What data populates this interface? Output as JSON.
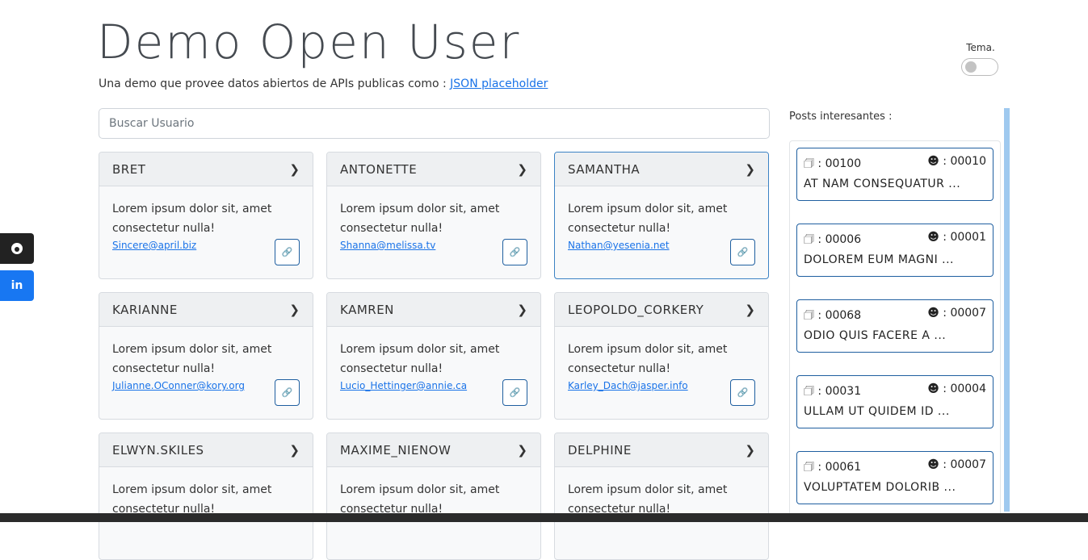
{
  "header": {
    "title": "Demo Open User",
    "subtitle": "Una demo que provee datos abiertos de APIs publicas como : ",
    "subtitle_link": "JSON placeholder",
    "theme_label": "Tema."
  },
  "search": {
    "placeholder": "Buscar Usuario"
  },
  "users": [
    {
      "name": "BRET",
      "text": "Lorem ipsum dolor sit, amet consectetur nulla!",
      "email": "Sincere@april.biz"
    },
    {
      "name": "ANTONETTE",
      "text": "Lorem ipsum dolor sit, amet consectetur nulla!",
      "email": "Shanna@melissa.tv"
    },
    {
      "name": "SAMANTHA",
      "text": "Lorem ipsum dolor sit, amet consectetur nulla!",
      "email": "Nathan@yesenia.net"
    },
    {
      "name": "KARIANNE",
      "text": "Lorem ipsum dolor sit, amet consectetur nulla!",
      "email": "Julianne.OConner@kory.org"
    },
    {
      "name": "KAMREN",
      "text": "Lorem ipsum dolor sit, amet consectetur nulla!",
      "email": "Lucio_Hettinger@annie.ca"
    },
    {
      "name": "LEOPOLDO_CORKERY",
      "text": "Lorem ipsum dolor sit, amet consectetur nulla!",
      "email": "Karley_Dach@jasper.info"
    },
    {
      "name": "ELWYN.SKILES",
      "text": "Lorem ipsum dolor sit, amet consectetur nulla!",
      "email": ""
    },
    {
      "name": "MAXIME_NIENOW",
      "text": "Lorem ipsum dolor sit, amet consectetur nulla!",
      "email": ""
    },
    {
      "name": "DELPHINE",
      "text": "Lorem ipsum dolor sit, amet consectetur nulla!",
      "email": ""
    }
  ],
  "sidebar": {
    "label": "Posts interesantes :",
    "posts": [
      {
        "post_id": ": 00100",
        "user_id": ": 00010",
        "title": "AT NAM CONSEQUATUR ..."
      },
      {
        "post_id": ": 00006",
        "user_id": ": 00001",
        "title": "DOLOREM EUM MAGNI ..."
      },
      {
        "post_id": ": 00068",
        "user_id": ": 00007",
        "title": "ODIO QUIS FACERE A ..."
      },
      {
        "post_id": ": 00031",
        "user_id": ": 00004",
        "title": "ULLAM UT QUIDEM ID ..."
      },
      {
        "post_id": ": 00061",
        "user_id": ": 00007",
        "title": "VOLUPTATEM DOLORIB ..."
      }
    ]
  },
  "social": {
    "github_icon": "github-icon",
    "linkedin_label": "in"
  },
  "colors": {
    "accent": "#1f5fa0",
    "link": "#1a73e8",
    "scroll": "#9fc9ef"
  }
}
